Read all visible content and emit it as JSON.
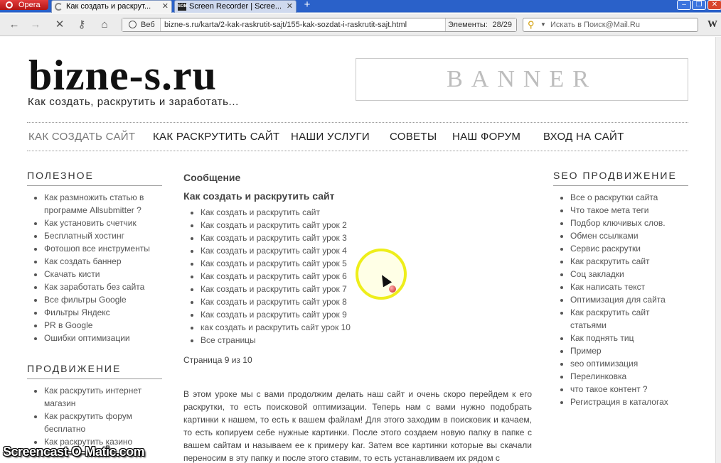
{
  "browser": {
    "opera_button": "Opera",
    "tabs": [
      {
        "title": "Как создать и раскрут..."
      },
      {
        "title": "Screen Recorder | Scree..."
      }
    ],
    "address": {
      "secure_label": "Веб",
      "url": "bizne-s.ru/karta/2-kak-raskrutit-sajt/155-kak-sozdat-i-raskrutit-sajt.html",
      "elements_label": "Элементы:",
      "elements_count": "28/29"
    },
    "search_placeholder": "Искать в Поиск@Mail.Ru"
  },
  "site": {
    "logo": "bizne-s.ru",
    "tagline": "Как создать, раскрутить и заработать...",
    "banner": "BANNER",
    "menu": [
      "Как создать сайт",
      "Как раскрутить сайт",
      "Наши услуги",
      "Советы",
      "Наш форум",
      "Вход на сайт"
    ]
  },
  "left_sidebar": {
    "useful_title": "Полезное",
    "useful_items": [
      "Как размножить статью в программе Allsubmitter ?",
      "Как установить счетчик",
      "Бесплатный хостинг",
      "Фотошоп все инструменты",
      "Как создать баннер",
      "Скачать кисти",
      "Как заработать без сайта",
      "Все фильтры Google",
      "Фильтры Яндекс",
      "PR в Google",
      "Ошибки оптимизации"
    ],
    "promo_title": "Продвижение",
    "promo_items": [
      "Как раскрутить интернет магазин",
      "Как раскрутить форум бесплатно",
      "Как раскрутить казино"
    ]
  },
  "main": {
    "message_title": "Сообщение",
    "article_title": "Как создать и раскрутить сайт",
    "lessons": [
      "Как создать и раскрутить сайт",
      "Как создать и раскрутить сайт урок 2",
      "Как создать и раскрутить сайт урок 3",
      "Как создать и раскрутить сайт урок 4",
      "Как создать и раскрутить сайт урок 5",
      "Как создать и раскрутить сайт урок 6",
      "Как создать и раскрутить сайт урок 7",
      "Как создать и раскрутить сайт урок 8",
      "Как создать и раскрутить сайт урок 9",
      "как создать и раскрутить сайт урок 10",
      "Все страницы"
    ],
    "pager": "Страница 9 из 10",
    "body": "В этом уроке мы с вами продолжим делать наш сайт и очень скоро перейдем к его раскрутки, то есть поисковой оптимизации. Теперь нам с вами нужно подобрать картинки к нашем, то есть к вашем файлам! Для этого заходим в поисковик и качаем, то есть копируем себе нужные картинки. После этого создаем новую папку в папке с вашем сайтам и называем ее к примеру kar. Затем все картинки которые вы скачали переносим в эту папку и после этого ставим, то есть устанавливаем их рядом с"
  },
  "right_sidebar": {
    "title": "SEO продвижение",
    "items": [
      "Все о раскрутки сайта",
      "Что такое мета теги",
      "Подбор ключивых слов.",
      "Обмен ссылками",
      "Сервис раскрутки",
      "Как раскрутить сайт",
      "Соц закладки",
      "Как написать текст",
      "Оптимизация для сайта",
      "Как раскрутить сайт статьями",
      "Как поднять тиц",
      "Пример",
      "seo оптимизация",
      "Перелинковка",
      "что такое контент ?",
      "Регистрация в каталогах"
    ]
  },
  "watermark": "Screencast-O-Matic.com"
}
